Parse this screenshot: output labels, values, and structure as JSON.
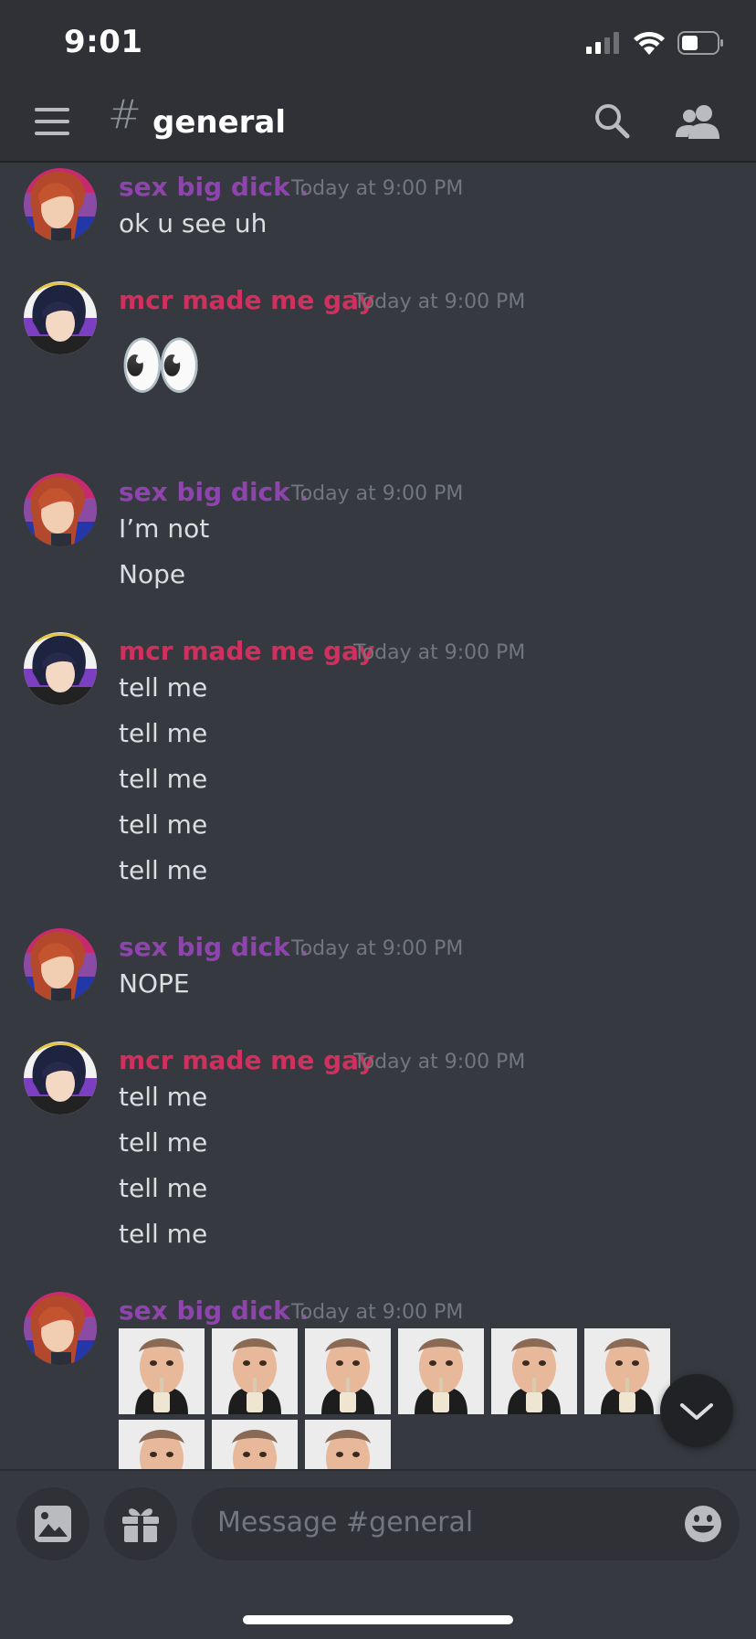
{
  "status_bar": {
    "time": "9:01"
  },
  "header": {
    "hash": "#",
    "channel": "general"
  },
  "messages": [
    {
      "user": "sex big dick .",
      "color": "#8e44ad",
      "time": "Today at 9:00 PM",
      "lines": [
        "ok u see uh"
      ]
    },
    {
      "user": "mcr made me gay",
      "color": "#d0305d",
      "time": "Today at 9:00 PM",
      "lines": [
        "👀"
      ]
    },
    {
      "user": "sex big dick .",
      "color": "#8e44ad",
      "time": "Today at 9:00 PM",
      "lines": [
        "I’m not",
        "Nope"
      ]
    },
    {
      "user": "mcr made me gay",
      "color": "#d0305d",
      "time": "Today at 9:00 PM",
      "lines": [
        "tell me",
        "tell me",
        "tell me",
        "tell me",
        "tell me"
      ]
    },
    {
      "user": "sex big dick .",
      "color": "#8e44ad",
      "time": "Today at 9:00 PM",
      "lines": [
        "NOPE"
      ]
    },
    {
      "user": "mcr made me gay",
      "color": "#d0305d",
      "time": "Today at 9:00 PM",
      "lines": [
        "tell me",
        "tell me",
        "tell me",
        "tell me"
      ]
    },
    {
      "user": "sex big dick .",
      "color": "#8e44ad",
      "time": "Today at 9:00 PM",
      "lines": [],
      "custom_emoji_count": 9
    }
  ],
  "composer": {
    "placeholder": "Message #general"
  },
  "icons": {
    "menu": "hamburger-menu-icon",
    "search": "search-icon",
    "members": "members-icon",
    "image": "image-icon",
    "gift": "gift-icon",
    "emoji": "emoji-icon",
    "jump": "chevron-down-icon"
  },
  "colors": {
    "background": "#36393f",
    "header": "#2f3136",
    "muted": "#72767d"
  }
}
